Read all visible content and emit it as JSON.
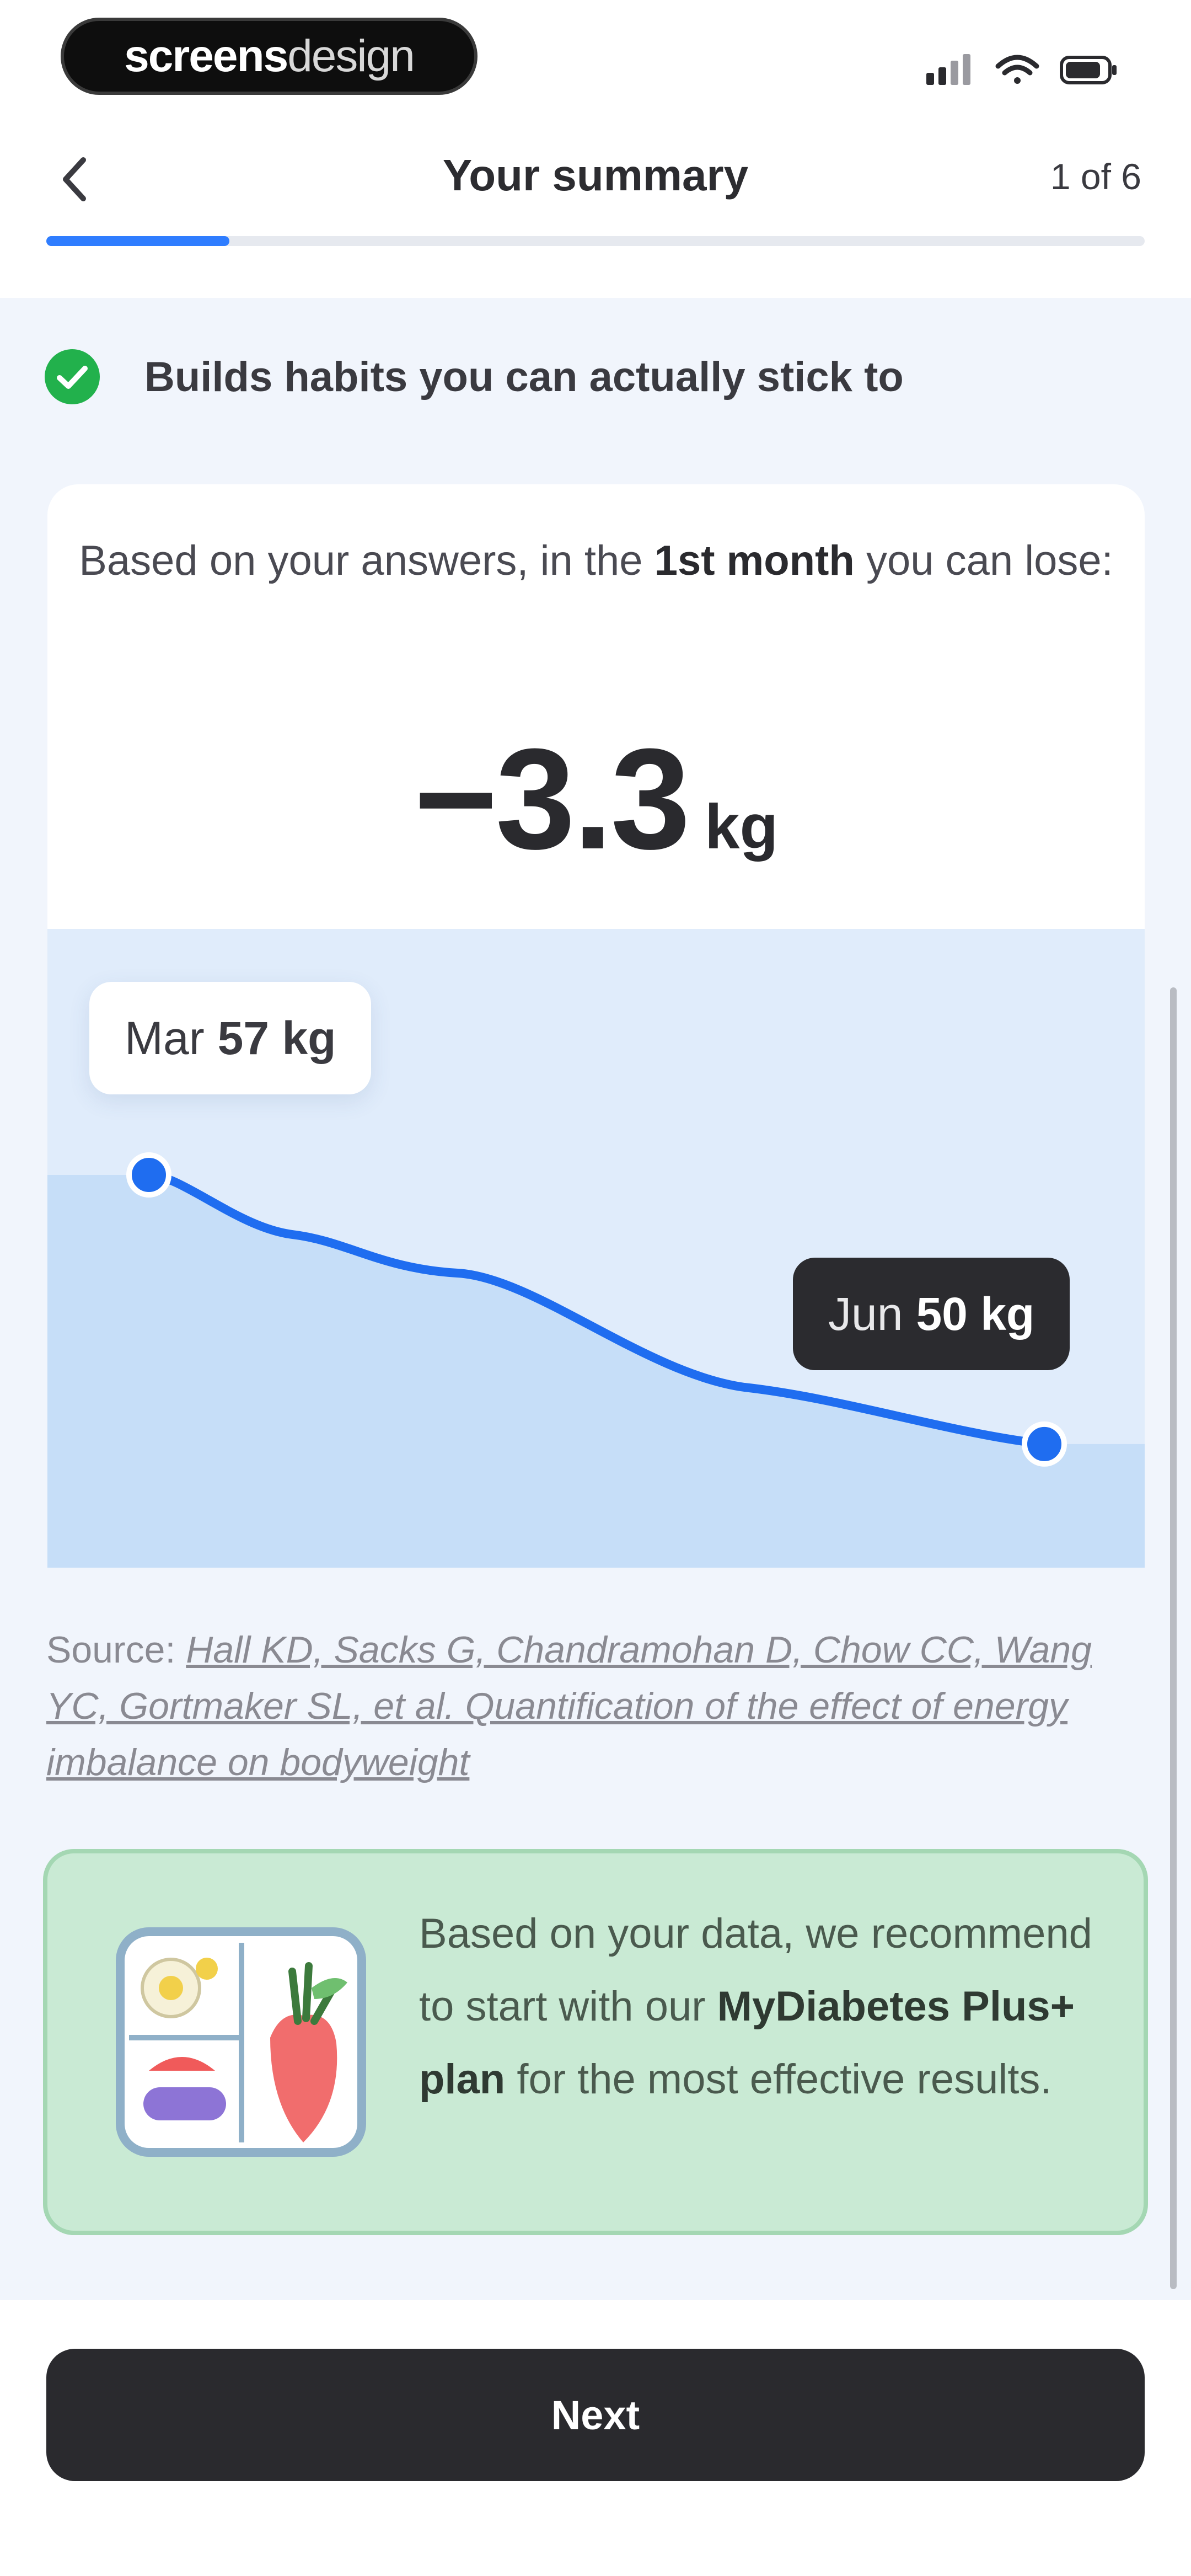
{
  "status_bar": {
    "brand_bold": "screens",
    "brand_light": "design",
    "icons": [
      "signal-icon",
      "wifi-icon",
      "battery-icon"
    ]
  },
  "header": {
    "title": "Your summary",
    "step": "1 of 6",
    "progress": 0.1667,
    "back_icon": "chevron-left-icon"
  },
  "habit": {
    "text": "Builds habits you can actually stick to",
    "icon": "check-circle-icon",
    "icon_color": "#22b14c"
  },
  "summary": {
    "intro_pre": "Based on your answers, in the",
    "intro_bold": "1st month",
    "intro_post": "you can lose:",
    "loss_value": "−3.3",
    "loss_unit": "kg"
  },
  "chart_data": {
    "type": "area",
    "x": [
      "Mar",
      "Jun"
    ],
    "series": [
      {
        "values": [
          57,
          50
        ]
      }
    ],
    "start": {
      "month": "Mar",
      "value": "57 kg"
    },
    "end": {
      "month": "Jun",
      "value": "50 kg"
    },
    "line_color": "#1f6df0",
    "fill_color": "#c6def8"
  },
  "source": {
    "label": "Source:",
    "link": "Hall KD, Sacks G, Chandramohan D, Chow CC, Wang YC, Gortmaker SL, et al. Quantification of the effect of energy imbalance on bodyweight"
  },
  "recommendation": {
    "text_pre": "Based on your data, we recommend to start with our",
    "plan": "MyDiabetes Plus+ plan",
    "text_post": "for the most effective results.",
    "illustration": "meal-plate-illustration"
  },
  "colors": {
    "accent": "#2f7dff",
    "dark": "#2a2a2e",
    "rec_bg": "#c9ead4",
    "page_bg": "#f1f5fc"
  },
  "footer": {
    "next_label": "Next"
  }
}
